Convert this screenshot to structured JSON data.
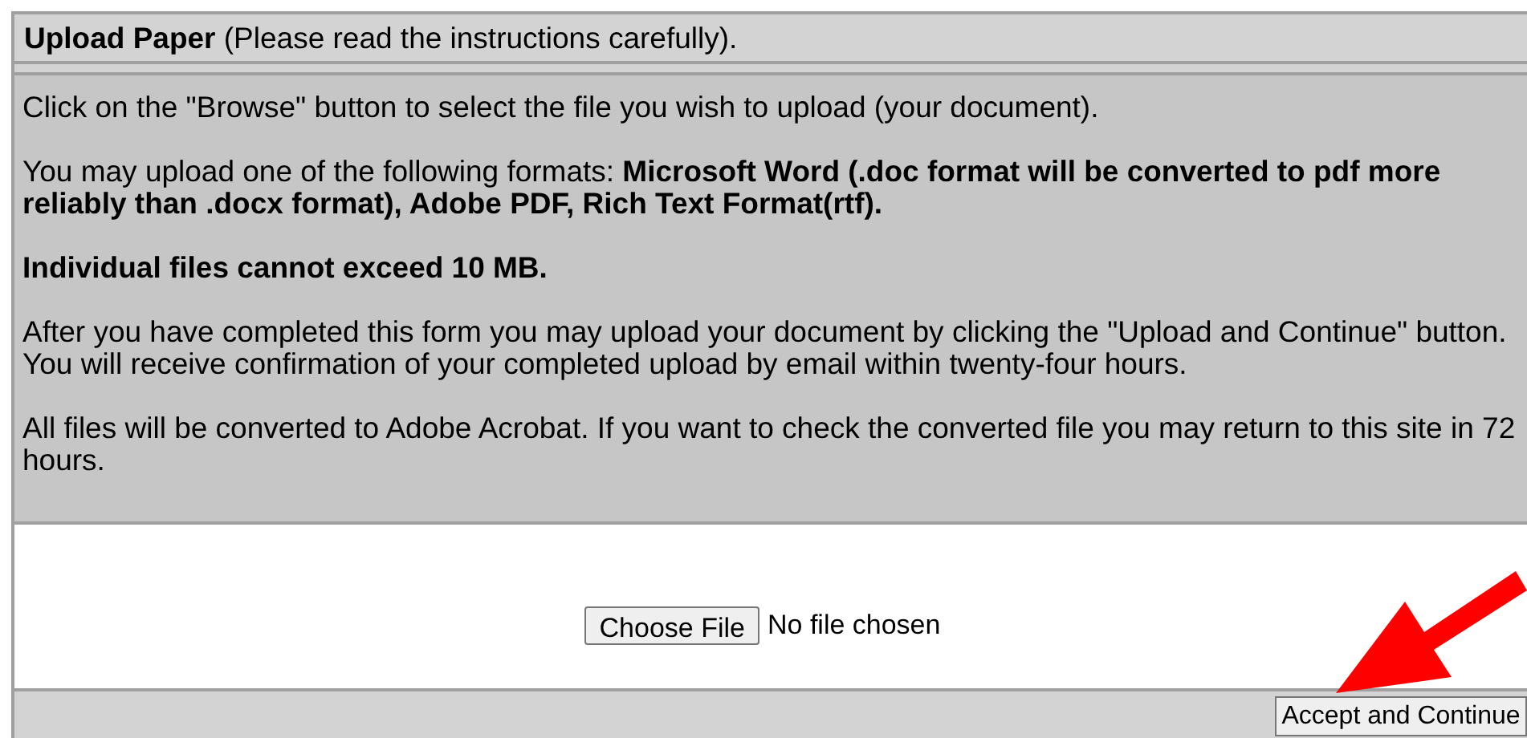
{
  "header": {
    "title": "Upload Paper",
    "subtitle": "(Please read the instructions carefully)."
  },
  "instructions": [
    {
      "text": "Click on the \"Browse\" button to select the file you wish to upload (your document).",
      "bold": false
    },
    {
      "text": "You may upload one of the following formats: **Microsoft Word (.doc format will be converted to pdf more reliably than .docx format), Adobe PDF, Rich Text Format(rtf).**",
      "bold": false
    },
    {
      "text": "Individual files cannot exceed 10 MB.",
      "bold": true
    },
    {
      "text": "After you have completed this form you may upload your document by clicking the \"Upload and Continue\" button. You will receive confirmation of your completed upload by email within twenty-four hours.",
      "bold": false
    },
    {
      "text": "All files will be converted to Adobe Acrobat. If you want to check the converted file you may return to this site in 72 hours.",
      "bold": false
    }
  ],
  "file_input": {
    "button": "Choose File",
    "status": "No file chosen"
  },
  "submit_button": "Accept and Continue"
}
